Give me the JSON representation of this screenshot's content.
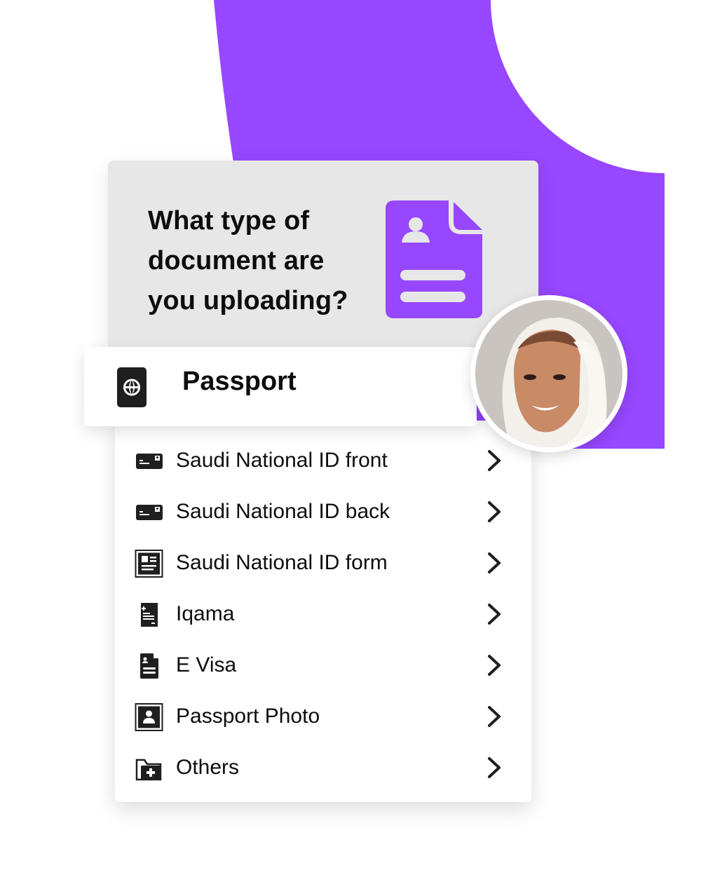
{
  "colors": {
    "accent": "#9747ff",
    "card_bg": "#e7e7e7",
    "text": "#0d0d0d",
    "icon_dark": "#1f1f1f"
  },
  "question": {
    "title": "What type of document are you uploading?",
    "icon": "document-person-icon"
  },
  "selected": {
    "label": "Passport",
    "icon": "passport-globe-icon"
  },
  "options": [
    {
      "label": "Saudi National ID front",
      "icon": "id-card-icon"
    },
    {
      "label": "Saudi National ID back",
      "icon": "id-card-icon"
    },
    {
      "label": "Saudi National ID form",
      "icon": "id-form-icon"
    },
    {
      "label": "Iqama",
      "icon": "receipt-icon"
    },
    {
      "label": "E Visa",
      "icon": "document-person-icon"
    },
    {
      "label": "Passport Photo",
      "icon": "portrait-icon"
    },
    {
      "label": "Others",
      "icon": "folder-plus-icon"
    }
  ],
  "avatar": {
    "description": "smiling woman wearing white hijab"
  }
}
